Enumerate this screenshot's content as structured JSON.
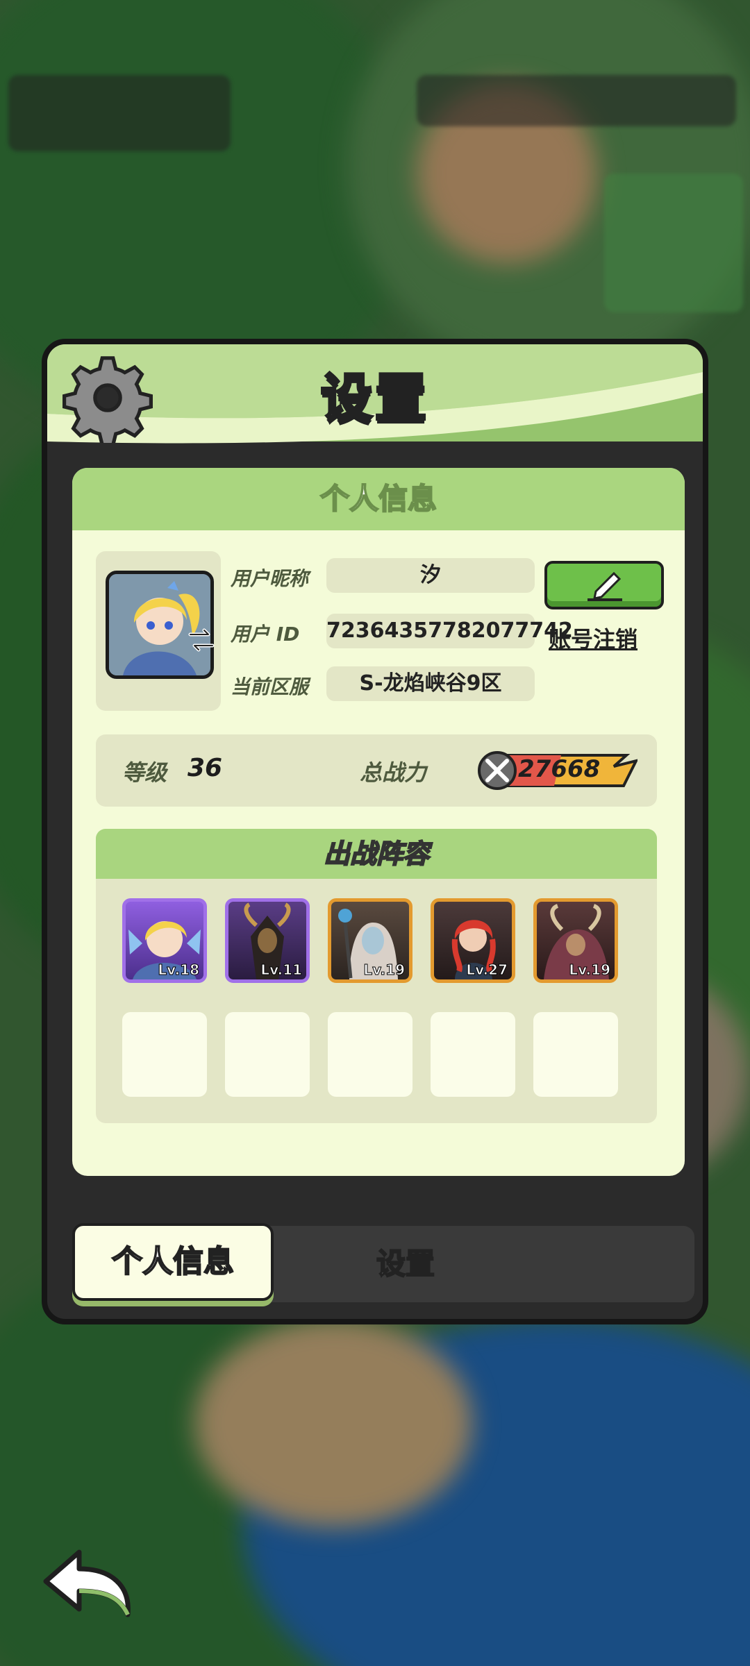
{
  "modal": {
    "title": "设置"
  },
  "profile_card": {
    "heading": "个人信息",
    "nickname_label": "用户昵称",
    "nickname_value": "汐",
    "id_label": "用户  ID",
    "id_value": "72364357782077742",
    "cancel_account_label": "账号注销",
    "server_label": "当前区服",
    "server_value": "S-龙焰峡谷9区"
  },
  "stats": {
    "level_label": "等级",
    "level_value": "36",
    "power_label": "总战力",
    "power_value": "27668"
  },
  "lineup": {
    "heading": "出战阵容",
    "heroes": [
      {
        "level": "Lv.18",
        "rarity_color": "#a070e8"
      },
      {
        "level": "Lv.11",
        "rarity_color": "#a070e8"
      },
      {
        "level": "Lv.19",
        "rarity_color": "#e39a2f"
      },
      {
        "level": "Lv.27",
        "rarity_color": "#e39a2f"
      },
      {
        "level": "Lv.19",
        "rarity_color": "#e39a2f"
      }
    ],
    "empty_slots": 5
  },
  "tabs": [
    {
      "label": "个人信息",
      "active": true
    },
    {
      "label": "设置",
      "active": false
    }
  ],
  "icons": {
    "settings": "gear-icon",
    "edit": "pencil-icon",
    "swap": "swap-arrows-icon",
    "power": "crossed-swords-icon",
    "back": "back-arrow-icon"
  },
  "colors": {
    "header_green": "#95c46d",
    "card_bg": "#f4fbd8",
    "edit_button": "#6ec04a"
  }
}
